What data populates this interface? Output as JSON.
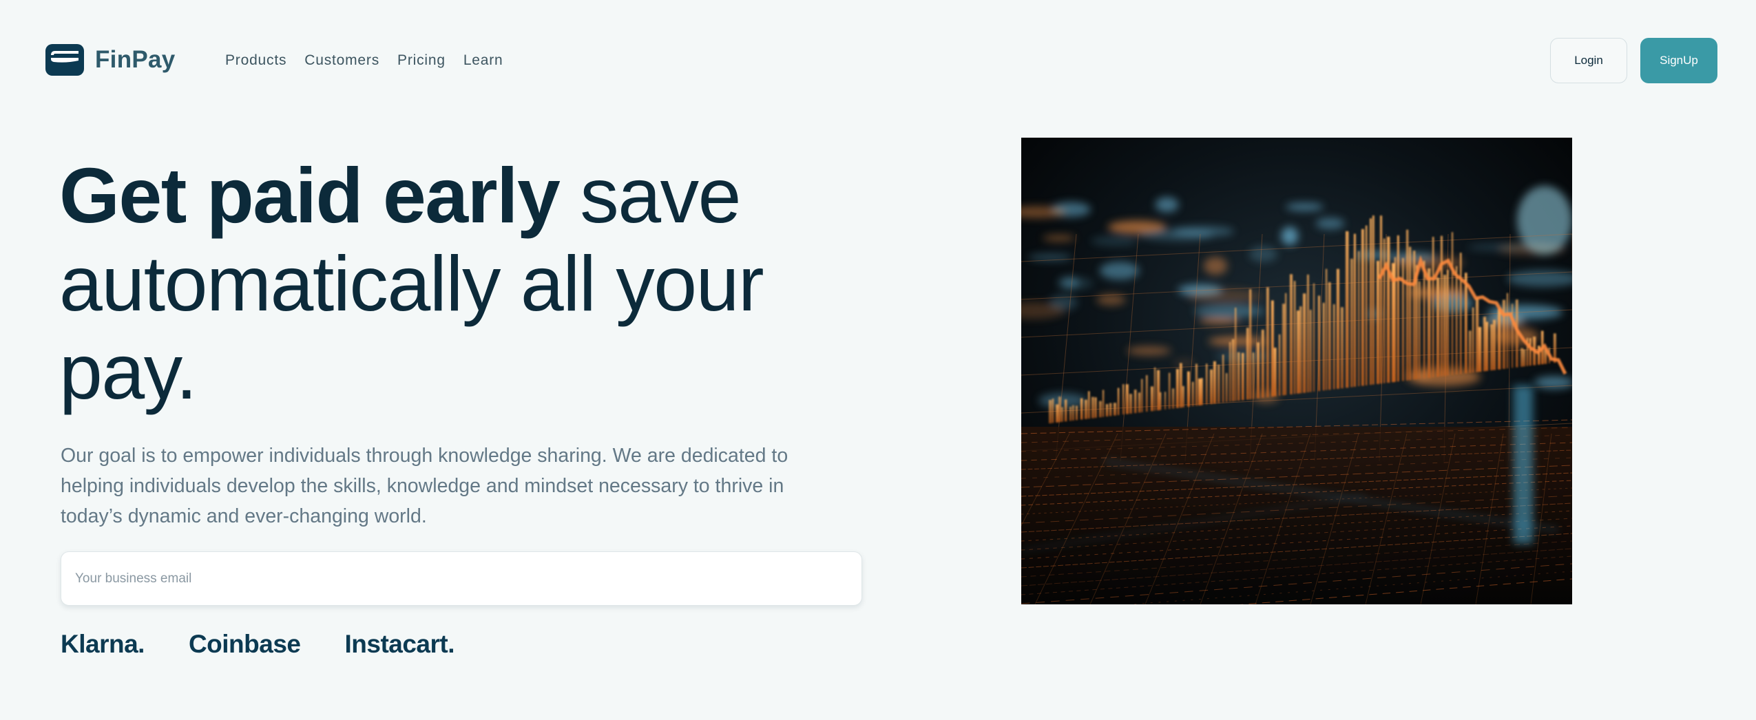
{
  "brand": {
    "name": "FinPay",
    "logo_icon": "wallet-icon"
  },
  "nav": {
    "items": [
      {
        "label": "Products"
      },
      {
        "label": "Customers"
      },
      {
        "label": "Pricing"
      },
      {
        "label": "Learn"
      }
    ]
  },
  "auth": {
    "login_label": "Login",
    "signup_label": "SignUp"
  },
  "hero": {
    "headline_strong": "Get paid early",
    "headline_rest": " save automatically all your pay.",
    "description": "Our goal is to empower individuals through knowledge sharing. We are dedicated to helping individuals develop the skills, knowledge and mindset necessary to thrive in today’s dynamic and ever-changing world.",
    "email_placeholder": "Your business email",
    "email_value": ""
  },
  "partners": [
    {
      "name": "Klarna."
    },
    {
      "name": "Coinbase"
    },
    {
      "name": "Instacart."
    }
  ],
  "colors": {
    "background": "#f4f8f8",
    "primary_dark": "#0c2a3a",
    "accent": "#3a9aa6",
    "muted_text": "#637886"
  }
}
